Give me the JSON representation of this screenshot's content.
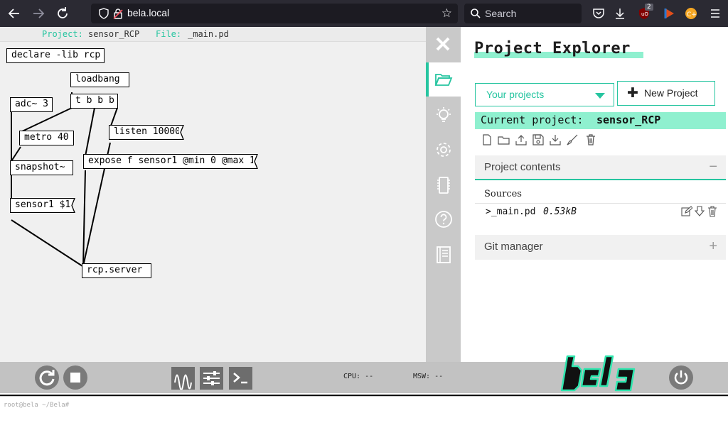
{
  "browser": {
    "url": "bela.local",
    "search_placeholder": "Search",
    "ublock_count": "2"
  },
  "editor": {
    "project_key": "Project:",
    "project_value": "sensor_RCP",
    "file_key": "File:",
    "file_value": "_main.pd",
    "objects": {
      "declare": "declare -lib rcp",
      "loadbang": "loadbang",
      "trigger": "t b b b",
      "adc": "adc~ 3",
      "metro": "metro 40",
      "listen": "listen 10000",
      "expose": "expose f sensor1 @min 0 @max 1",
      "snapshot": "snapshot~",
      "sensor_msg": "sensor1 $1",
      "rcp_server": "rcp.server"
    }
  },
  "explorer": {
    "title": "Project Explorer",
    "select_value": "Your projects",
    "new_project": "New Project",
    "current_label": "Current project:",
    "current_name": "sensor_RCP",
    "contents_title": "Project contents",
    "contents_toggle": "−",
    "sources_label": "Sources",
    "files": [
      {
        "name": ">_main.pd",
        "size": "0.53kB"
      }
    ],
    "git_title": "Git manager",
    "git_toggle": "+"
  },
  "toolbar": {
    "cpu_label": "CPU: --",
    "msw_label": "MSW: --"
  },
  "console": {
    "prompt": "root@bela ~/Bela#"
  },
  "colors": {
    "accent": "#26c5a0",
    "highlight": "#8ff0cf"
  }
}
